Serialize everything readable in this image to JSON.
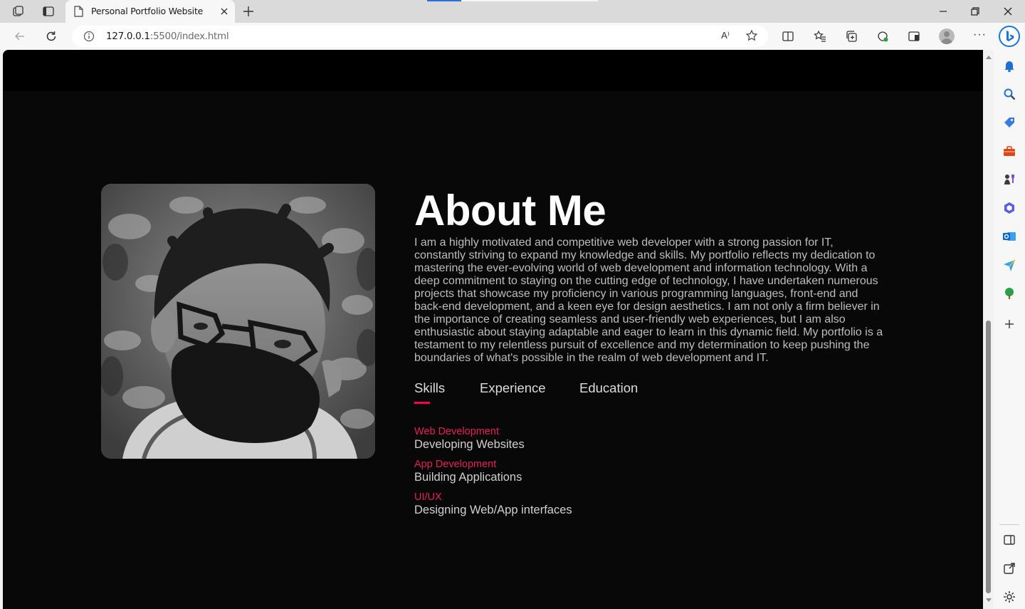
{
  "browser": {
    "tab_title": "Personal Portfolio Website",
    "url_host": "127.0.0.1",
    "url_rest": ":5500/index.html",
    "read_aloud": "A⁾"
  },
  "about": {
    "title": "About Me",
    "paragraph": "I am a highly motivated and competitive web developer with a strong passion for IT, constantly striving to expand my knowledge and skills. My portfolio reflects my dedication to mastering the ever-evolving world of web development and information technology. With a deep commitment to staying on the cutting edge of technology, I have undertaken numerous projects that showcase my proficiency in various programming languages, front-end and back-end development, and a keen eye for design aesthetics. I am not only a firm believer in the importance of creating seamless and user-friendly web experiences, but I am also enthusiastic about staying adaptable and eager to learn in this dynamic field. My portfolio is a testament to my relentless pursuit of excellence and my determination to keep pushing the boundaries of what's possible in the realm of web development and IT."
  },
  "tabs": [
    {
      "label": "Skills",
      "active": true
    },
    {
      "label": "Experience",
      "active": false
    },
    {
      "label": "Education",
      "active": false
    }
  ],
  "skills": [
    {
      "category": "Web Development",
      "description": "Developing Websites"
    },
    {
      "category": "App Development",
      "description": "Building Applications"
    },
    {
      "category": "UI/UX",
      "description": "Designing Web/App interfaces"
    }
  ],
  "colors": {
    "accent": "#ff004f",
    "page_bg": "#080808",
    "header_bg": "#000000"
  },
  "icons": {
    "sidebar": [
      "bell-icon",
      "search-icon",
      "tag-icon",
      "toolbox-icon",
      "chess-icon",
      "copilot-icon",
      "outlook-icon",
      "send-icon",
      "tree-icon",
      "plus-icon",
      "sidebar-toggle-icon",
      "external-link-icon",
      "settings-icon"
    ]
  },
  "photo_alt": "Portrait photo"
}
